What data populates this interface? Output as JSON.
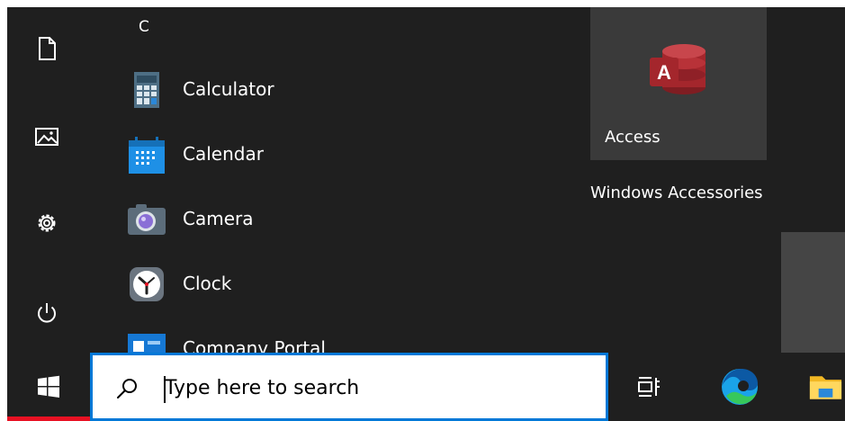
{
  "start_menu": {
    "section_letter": "C",
    "rail": [
      "document-icon",
      "pictures-icon",
      "settings-gear-icon",
      "power-icon"
    ],
    "apps": [
      {
        "label": "Calculator",
        "icon": "calculator-icon"
      },
      {
        "label": "Calendar",
        "icon": "calendar-icon"
      },
      {
        "label": "Camera",
        "icon": "camera-icon"
      },
      {
        "label": "Clock",
        "icon": "clock-icon"
      },
      {
        "label": "Company Portal",
        "icon": "company-portal-icon"
      }
    ],
    "tiles": {
      "access": {
        "label": "Access",
        "icon": "access-icon"
      },
      "group_label": "Windows Accessories"
    }
  },
  "taskbar": {
    "start_icon": "windows-logo-icon",
    "search_placeholder": "Type here to search",
    "search_icon": "search-icon",
    "buttons": [
      "task-view-icon",
      "edge-icon",
      "file-explorer-icon"
    ]
  },
  "colors": {
    "menu_background": "#1f1f1f",
    "tile_background": "#3a3a3a",
    "accent": "#0078d7",
    "start_indicator": "#e81123",
    "access_red": "#a4262c"
  }
}
